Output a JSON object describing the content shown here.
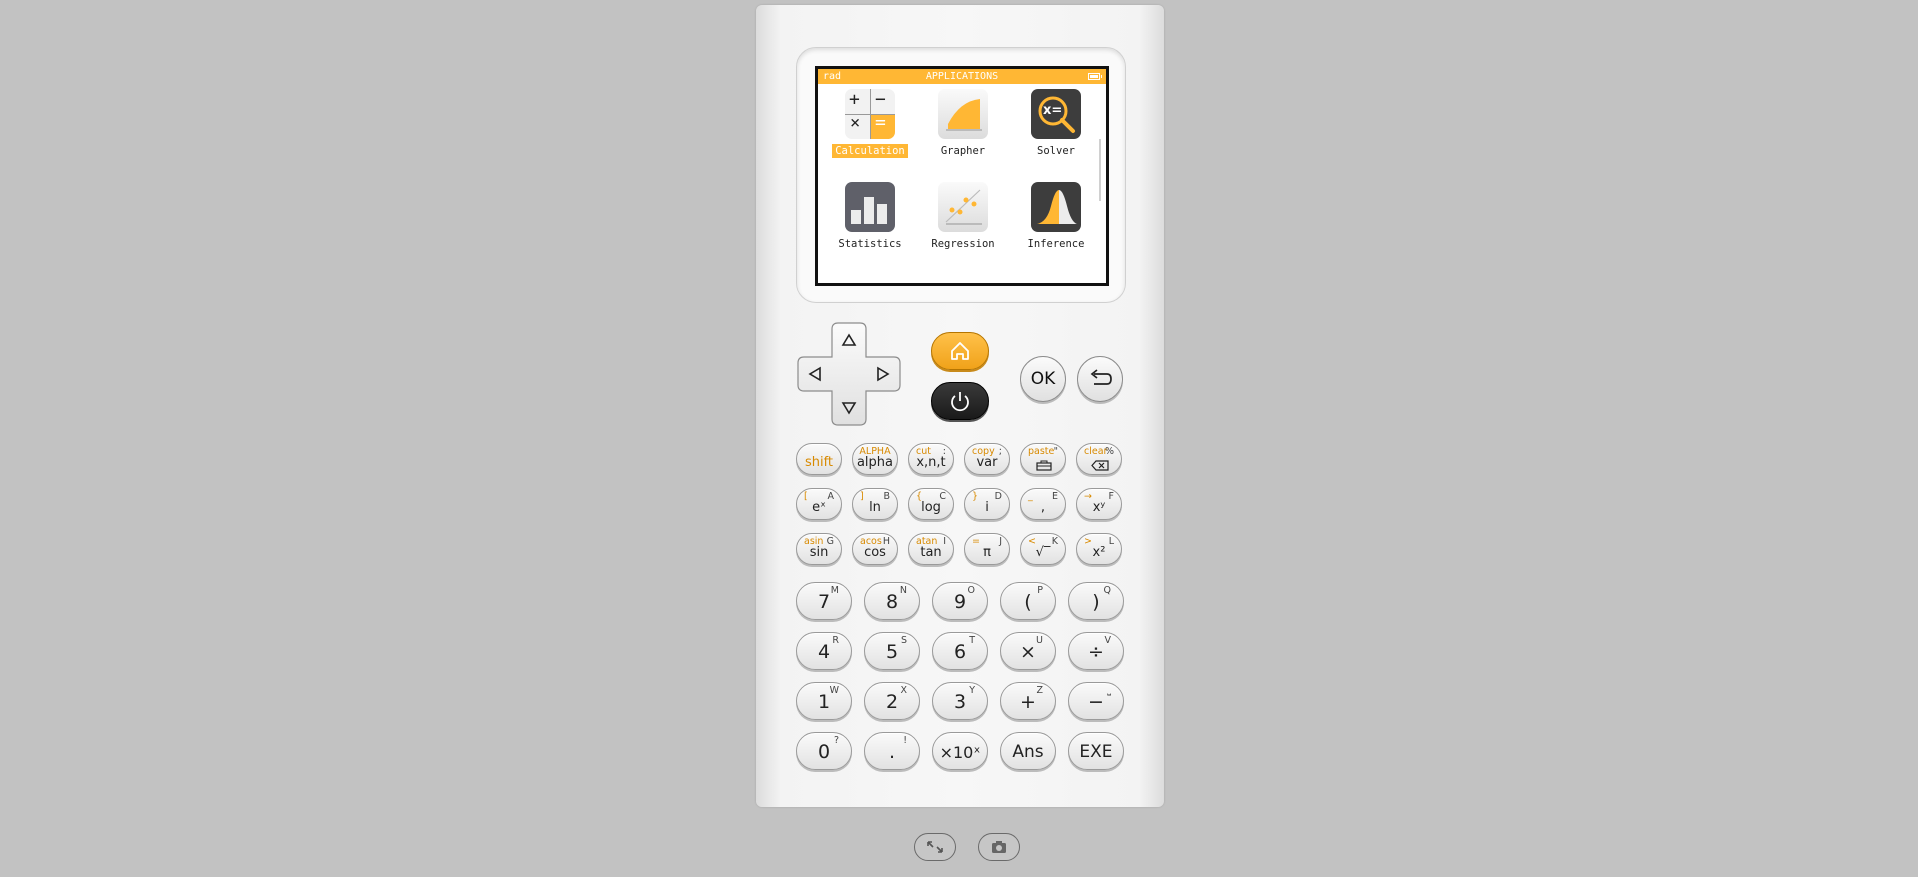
{
  "status": {
    "mode": "rad",
    "title": "APPLICATIONS"
  },
  "apps": [
    {
      "name": "calculation",
      "label": "Calculation",
      "selected": true
    },
    {
      "name": "grapher",
      "label": "Grapher"
    },
    {
      "name": "solver",
      "label": "Solver"
    },
    {
      "name": "statistics",
      "label": "Statistics"
    },
    {
      "name": "regression",
      "label": "Regression"
    },
    {
      "name": "inference",
      "label": "Inference"
    }
  ],
  "solver_glyph": "x=",
  "calc_glyphs": {
    "plus": "+",
    "minus": "−",
    "times": "×",
    "equals": "="
  },
  "nav": {
    "ok": "OK"
  },
  "fkeys_row1": [
    {
      "main": "shift",
      "sl": "",
      "sr": ""
    },
    {
      "main": "alpha",
      "sl": "ALPHA",
      "sr": ""
    },
    {
      "main": "x,n,t",
      "sl": "cut",
      "sr": ":"
    },
    {
      "main": "var",
      "sl": "copy",
      "sr": ";"
    },
    {
      "main": "",
      "sl": "paste",
      "sr": "\""
    },
    {
      "main": "",
      "sl": "clear",
      "sr": "%"
    }
  ],
  "fkeys_row2": [
    {
      "main": "eˣ",
      "sl": "[",
      "sr": "A"
    },
    {
      "main": "ln",
      "sl": "]",
      "sr": "B"
    },
    {
      "main": "log",
      "sl": "{",
      "sr": "C"
    },
    {
      "main": "i",
      "sl": "}",
      "sr": "D"
    },
    {
      "main": ",",
      "sl": "_",
      "sr": "E"
    },
    {
      "main": "xʸ",
      "sl": "→",
      "sr": "F"
    }
  ],
  "fkeys_row3": [
    {
      "main": "sin",
      "sl": "asin",
      "sr": "G"
    },
    {
      "main": "cos",
      "sl": "acos",
      "sr": "H"
    },
    {
      "main": "tan",
      "sl": "atan",
      "sr": "I"
    },
    {
      "main": "π",
      "sl": "=",
      "sr": "J"
    },
    {
      "main": "√‾",
      "sl": "<",
      "sr": "K"
    },
    {
      "main": "x²",
      "sl": ">",
      "sr": "L"
    }
  ],
  "nkeys": [
    [
      {
        "main": "7",
        "sr": "M"
      },
      {
        "main": "8",
        "sr": "N"
      },
      {
        "main": "9",
        "sr": "O"
      },
      {
        "main": "(",
        "sr": "P"
      },
      {
        "main": ")",
        "sr": "Q"
      }
    ],
    [
      {
        "main": "4",
        "sr": "R"
      },
      {
        "main": "5",
        "sr": "S"
      },
      {
        "main": "6",
        "sr": "T"
      },
      {
        "main": "×",
        "sr": "U"
      },
      {
        "main": "÷",
        "sr": "V"
      }
    ],
    [
      {
        "main": "1",
        "sr": "W"
      },
      {
        "main": "2",
        "sr": "X"
      },
      {
        "main": "3",
        "sr": "Y"
      },
      {
        "main": "+",
        "sr": "Z"
      },
      {
        "main": "−",
        "sr": "⎵"
      }
    ],
    [
      {
        "main": "0",
        "sr": "?"
      },
      {
        "main": ".",
        "sr": "!"
      },
      {
        "main": "×10ˣ",
        "sr": ""
      },
      {
        "main": "Ans",
        "sr": ""
      },
      {
        "main": "EXE",
        "sr": ""
      }
    ]
  ],
  "colors": {
    "accent": "#ffb734",
    "background": "#c2c2c2",
    "dark_icon": "#3d3d3d"
  }
}
